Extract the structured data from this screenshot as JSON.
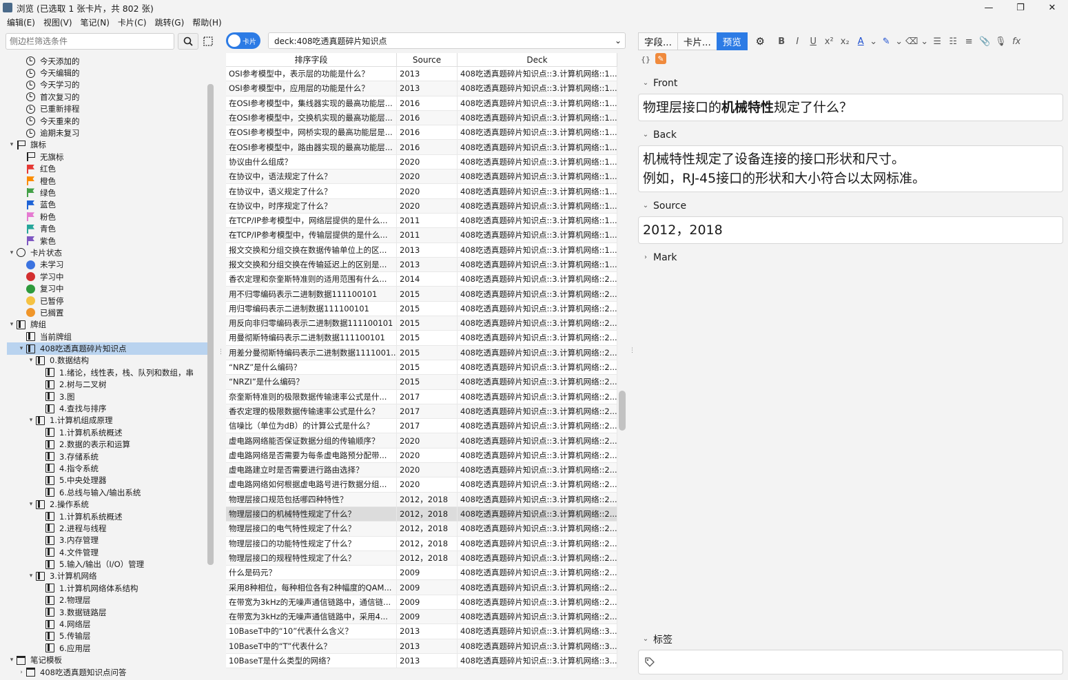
{
  "window": {
    "title": "浏览 (已选取 1 张卡片，共 802 张)",
    "minimize": "—",
    "maximize": "❐",
    "close": "✕"
  },
  "menu": [
    "编辑(E)",
    "视图(V)",
    "笔记(N)",
    "卡片(C)",
    "跳转(G)",
    "帮助(H)"
  ],
  "sidebar": {
    "search_placeholder": "侧边栏筛选条件",
    "items": [
      {
        "label": "今天添加的",
        "icon": "clock",
        "indent": 1
      },
      {
        "label": "今天编辑的",
        "icon": "clock",
        "indent": 1
      },
      {
        "label": "今天学习的",
        "icon": "clock",
        "indent": 1
      },
      {
        "label": "首次复习的",
        "icon": "clock",
        "indent": 1
      },
      {
        "label": "已重新排程",
        "icon": "clock",
        "indent": 1
      },
      {
        "label": "今天重来的",
        "icon": "clock",
        "indent": 1
      },
      {
        "label": "逾期未复习",
        "icon": "clock",
        "indent": 1
      },
      {
        "label": "旗标",
        "icon": "flag-outline",
        "indent": 0,
        "arrow": "▾"
      },
      {
        "label": "无旗标",
        "icon": "flag-none",
        "indent": 1
      },
      {
        "label": "红色",
        "icon": "flag",
        "color": "#e53935",
        "indent": 1
      },
      {
        "label": "橙色",
        "icon": "flag",
        "color": "#fb8c00",
        "indent": 1
      },
      {
        "label": "绿色",
        "icon": "flag",
        "color": "#43a047",
        "indent": 1
      },
      {
        "label": "蓝色",
        "icon": "flag",
        "color": "#1e63d6",
        "indent": 1
      },
      {
        "label": "粉色",
        "icon": "flag",
        "color": "#e57ad1",
        "indent": 1
      },
      {
        "label": "青色",
        "icon": "flag",
        "color": "#26a69a",
        "indent": 1
      },
      {
        "label": "紫色",
        "icon": "flag",
        "color": "#7e57c2",
        "indent": 1
      },
      {
        "label": "卡片状态",
        "icon": "circle",
        "indent": 0,
        "arrow": "▾"
      },
      {
        "label": "未学习",
        "icon": "dot",
        "color": "#3b73e0",
        "indent": 1
      },
      {
        "label": "学习中",
        "icon": "dot",
        "color": "#d32f2f",
        "indent": 1
      },
      {
        "label": "复习中",
        "icon": "dot",
        "color": "#2e9a3c",
        "indent": 1
      },
      {
        "label": "已暂停",
        "icon": "dot",
        "color": "#f5c242",
        "indent": 1
      },
      {
        "label": "已搁置",
        "icon": "dot",
        "color": "#f0962a",
        "indent": 1
      },
      {
        "label": "牌组",
        "icon": "deck",
        "indent": 0,
        "arrow": "▾"
      },
      {
        "label": "当前牌组",
        "icon": "deck",
        "indent": 1
      },
      {
        "label": "408吃透真题碎片知识点",
        "icon": "deck",
        "indent": 1,
        "arrow": "▾",
        "selected": true
      },
      {
        "label": "0.数据结构",
        "icon": "deck",
        "indent": 2,
        "arrow": "▾"
      },
      {
        "label": "1.绪论，线性表，栈、队列和数组，串",
        "icon": "deck",
        "indent": 3
      },
      {
        "label": "2.树与二叉树",
        "icon": "deck",
        "indent": 3
      },
      {
        "label": "3.图",
        "icon": "deck",
        "indent": 3
      },
      {
        "label": "4.查找与排序",
        "icon": "deck",
        "indent": 3
      },
      {
        "label": "1.计算机组成原理",
        "icon": "deck",
        "indent": 2,
        "arrow": "▾"
      },
      {
        "label": "1.计算机系统概述",
        "icon": "deck",
        "indent": 3
      },
      {
        "label": "2.数据的表示和运算",
        "icon": "deck",
        "indent": 3
      },
      {
        "label": "3.存储系统",
        "icon": "deck",
        "indent": 3
      },
      {
        "label": "4.指令系统",
        "icon": "deck",
        "indent": 3
      },
      {
        "label": "5.中央处理器",
        "icon": "deck",
        "indent": 3
      },
      {
        "label": "6.总线与输入/输出系统",
        "icon": "deck",
        "indent": 3
      },
      {
        "label": "2.操作系统",
        "icon": "deck",
        "indent": 2,
        "arrow": "▾"
      },
      {
        "label": "1.计算机系统概述",
        "icon": "deck",
        "indent": 3
      },
      {
        "label": "2.进程与线程",
        "icon": "deck",
        "indent": 3
      },
      {
        "label": "3.内存管理",
        "icon": "deck",
        "indent": 3
      },
      {
        "label": "4.文件管理",
        "icon": "deck",
        "indent": 3
      },
      {
        "label": "5.输入/输出（I/O）管理",
        "icon": "deck",
        "indent": 3
      },
      {
        "label": "3.计算机网络",
        "icon": "deck",
        "indent": 2,
        "arrow": "▾"
      },
      {
        "label": "1.计算机网络体系结构",
        "icon": "deck",
        "indent": 3
      },
      {
        "label": "2.物理层",
        "icon": "deck",
        "indent": 3
      },
      {
        "label": "3.数据链路层",
        "icon": "deck",
        "indent": 3
      },
      {
        "label": "4.网络层",
        "icon": "deck",
        "indent": 3
      },
      {
        "label": "5.传输层",
        "icon": "deck",
        "indent": 3
      },
      {
        "label": "6.应用层",
        "icon": "deck",
        "indent": 3
      },
      {
        "label": "笔记模板",
        "icon": "note",
        "indent": 0,
        "arrow": "▾"
      },
      {
        "label": "408吃透真题知识点问答",
        "icon": "note",
        "indent": 1,
        "arrow": "›"
      }
    ]
  },
  "toggle_label": "卡片",
  "search_query": "deck:408吃透真题碎片知识点",
  "table": {
    "columns": [
      "排序字段",
      "Source",
      "Deck"
    ],
    "rows": [
      [
        "OSI参考模型中，表示层的功能是什么？",
        "2013",
        "408吃透真题碎片知识点::3.计算机网络::1...."
      ],
      [
        "OSI参考模型中，应用层的功能是什么？",
        "2013",
        "408吃透真题碎片知识点::3.计算机网络::1...."
      ],
      [
        "在OSI参考模型中，集线器实现的最高功能层...",
        "2016",
        "408吃透真题碎片知识点::3.计算机网络::1...."
      ],
      [
        "在OSI参考模型中，交换机实现的最高功能层...",
        "2016",
        "408吃透真题碎片知识点::3.计算机网络::1...."
      ],
      [
        "在OSI参考模型中，网桥实现的最高功能层是...",
        "2016",
        "408吃透真题碎片知识点::3.计算机网络::1...."
      ],
      [
        "在OSI参考模型中，路由器实现的最高功能层...",
        "2016",
        "408吃透真题碎片知识点::3.计算机网络::1...."
      ],
      [
        "协议由什么组成？",
        "2020",
        "408吃透真题碎片知识点::3.计算机网络::1...."
      ],
      [
        "在协议中，语法规定了什么？",
        "2020",
        "408吃透真题碎片知识点::3.计算机网络::1...."
      ],
      [
        "在协议中，语义规定了什么？",
        "2020",
        "408吃透真题碎片知识点::3.计算机网络::1...."
      ],
      [
        "在协议中，时序规定了什么？",
        "2020",
        "408吃透真题碎片知识点::3.计算机网络::1...."
      ],
      [
        "在TCP/IP参考模型中，网络层提供的是什么...",
        "2011",
        "408吃透真题碎片知识点::3.计算机网络::1...."
      ],
      [
        "在TCP/IP参考模型中，传输层提供的是什么...",
        "2011",
        "408吃透真题碎片知识点::3.计算机网络::1...."
      ],
      [
        "报文交换和分组交换在数据传输单位上的区...",
        "2013",
        "408吃透真题碎片知识点::3.计算机网络::1...."
      ],
      [
        "报文交换和分组交换在传输延迟上的区别是...",
        "2013",
        "408吃透真题碎片知识点::3.计算机网络::1...."
      ],
      [
        "香农定理和奈奎斯特准则的适用范围有什么...",
        "2014",
        "408吃透真题碎片知识点::3.计算机网络::2...."
      ],
      [
        "用不归零编码表示二进制数据111100101",
        "2015",
        "408吃透真题碎片知识点::3.计算机网络::2...."
      ],
      [
        "用归零编码表示二进制数据111100101",
        "2015",
        "408吃透真题碎片知识点::3.计算机网络::2...."
      ],
      [
        "用反向非归零编码表示二进制数据111100101",
        "2015",
        "408吃透真题碎片知识点::3.计算机网络::2...."
      ],
      [
        "用曼彻斯特编码表示二进制数据111100101",
        "2015",
        "408吃透真题碎片知识点::3.计算机网络::2...."
      ],
      [
        "用差分曼彻斯特编码表示二进制数据1111001...",
        "2015",
        "408吃透真题碎片知识点::3.计算机网络::2...."
      ],
      [
        "“NRZ”是什么编码？",
        "2015",
        "408吃透真题碎片知识点::3.计算机网络::2...."
      ],
      [
        "“NRZI”是什么编码？",
        "2015",
        "408吃透真题碎片知识点::3.计算机网络::2...."
      ],
      [
        "奈奎斯特准则的极限数据传输速率公式是什...",
        "2017",
        "408吃透真题碎片知识点::3.计算机网络::2...."
      ],
      [
        "香农定理的极限数据传输速率公式是什么？",
        "2017",
        "408吃透真题碎片知识点::3.计算机网络::2...."
      ],
      [
        "信噪比（单位为dB）的计算公式是什么？",
        "2017",
        "408吃透真题碎片知识点::3.计算机网络::2...."
      ],
      [
        "虚电路网络能否保证数据分组的传输顺序？",
        "2020",
        "408吃透真题碎片知识点::3.计算机网络::2...."
      ],
      [
        "虚电路网络是否需要为每条虚电路预分配带...",
        "2020",
        "408吃透真题碎片知识点::3.计算机网络::2...."
      ],
      [
        "虚电路建立时是否需要进行路由选择？",
        "2020",
        "408吃透真题碎片知识点::3.计算机网络::2...."
      ],
      [
        "虚电路网络如何根据虚电路号进行数据分组...",
        "2020",
        "408吃透真题碎片知识点::3.计算机网络::2...."
      ],
      [
        "物理层接口规范包括哪四种特性？",
        "2012，2018",
        "408吃透真题碎片知识点::3.计算机网络::2...."
      ],
      [
        "物理层接口的机械特性规定了什么？",
        "2012，2018",
        "408吃透真题碎片知识点::3.计算机网络::2...."
      ],
      [
        "物理层接口的电气特性规定了什么？",
        "2012，2018",
        "408吃透真题碎片知识点::3.计算机网络::2...."
      ],
      [
        "物理层接口的功能特性规定了什么？",
        "2012，2018",
        "408吃透真题碎片知识点::3.计算机网络::2...."
      ],
      [
        "物理层接口的规程特性规定了什么？",
        "2012，2018",
        "408吃透真题碎片知识点::3.计算机网络::2...."
      ],
      [
        "什么是码元？",
        "2009",
        "408吃透真题碎片知识点::3.计算机网络::2...."
      ],
      [
        "采用8种相位，每种相位各有2种幅度的QAM...",
        "2009",
        "408吃透真题碎片知识点::3.计算机网络::2...."
      ],
      [
        "在带宽为3kHz的无噪声通信链路中，通信链...",
        "2009",
        "408吃透真题碎片知识点::3.计算机网络::2...."
      ],
      [
        "在带宽为3kHz的无噪声通信链路中，采用4...",
        "2009",
        "408吃透真题碎片知识点::3.计算机网络::2...."
      ],
      [
        "10BaseT中的“10”代表什么含义？",
        "2013",
        "408吃透真题碎片知识点::3.计算机网络::3...."
      ],
      [
        "10BaseT中的“T”代表什么？",
        "2013",
        "408吃透真题碎片知识点::3.计算机网络::3...."
      ],
      [
        "10BaseT是什么类型的网络？",
        "2013",
        "408吃透真题碎片知识点::3.计算机网络::3...."
      ]
    ],
    "selected_index": 30
  },
  "editor": {
    "tab_fields": "字段...",
    "tab_cards": "卡片...",
    "tab_preview": "预览",
    "format_buttons": [
      "B",
      "I",
      "U",
      "x²",
      "x₂",
      "A",
      "⌄",
      "✎",
      "⌄",
      "⌫",
      "⌄",
      "☰",
      "☷",
      "≡",
      "📎",
      "🎙",
      "fx"
    ],
    "fields": [
      {
        "name": "Front",
        "expanded": true,
        "pre": "物理层接口的",
        "bold": "机械特性",
        "post": "规定了什么？"
      },
      {
        "name": "Back",
        "expanded": true,
        "lines": [
          "机械特性规定了设备连接的接口形状和尺寸。",
          "例如，RJ-45接口的形状和大小符合以太网标准。"
        ]
      },
      {
        "name": "Source",
        "expanded": true,
        "value": "2012，2018"
      },
      {
        "name": "Mark",
        "expanded": false
      }
    ],
    "tags_label": "标签"
  },
  "colors": {
    "accent": "#2c7be5",
    "selected_row": "#dcdcdc",
    "sidebar_selected": "#b9d3ef"
  }
}
